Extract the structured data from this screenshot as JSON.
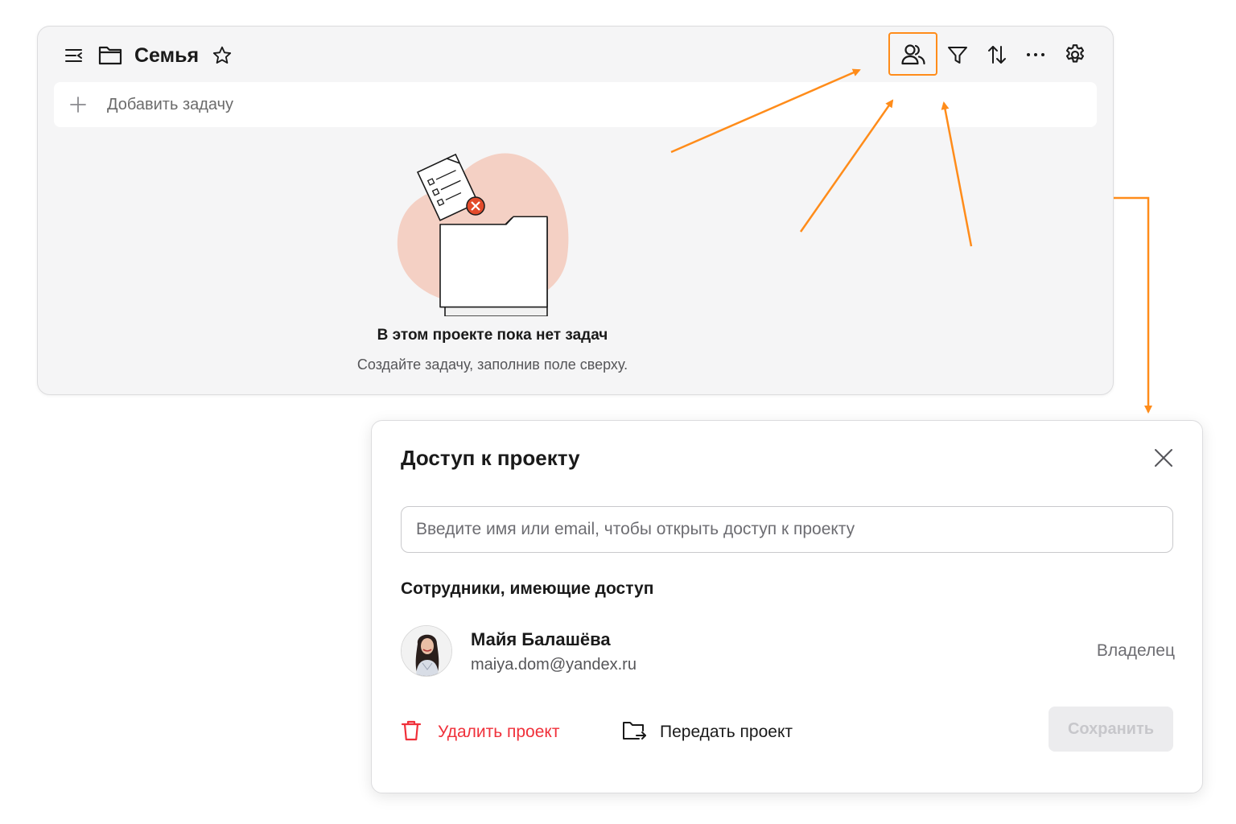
{
  "project": {
    "title": "Семья",
    "add_task_placeholder": "Добавить задачу",
    "empty_state": {
      "title": "В этом проекте пока нет задач",
      "subtitle": "Создайте задачу, заполнив поле сверху."
    },
    "toolbar": {
      "icons": [
        "menu-collapse-icon",
        "folder-icon",
        "star-icon",
        "users-icon",
        "filter-icon",
        "sort-icon",
        "more-icon",
        "settings-icon"
      ],
      "highlighted": "users-icon"
    }
  },
  "access_dialog": {
    "title": "Доступ к проекту",
    "search_placeholder": "Введите имя или email, чтобы открыть доступ к проекту",
    "members_heading": "Сотрудники, имеющие доступ",
    "members": [
      {
        "name": "Майя Балашёва",
        "email": "maiya.dom@yandex.ru",
        "role": "Владелец"
      }
    ],
    "delete_label": "Удалить проект",
    "transfer_label": "Передать проект",
    "save_label": "Сохранить"
  },
  "colors": {
    "accent_orange": "#ff8c1a",
    "danger_red": "#f0303a",
    "illustration_blob": "#f4d0c4"
  }
}
